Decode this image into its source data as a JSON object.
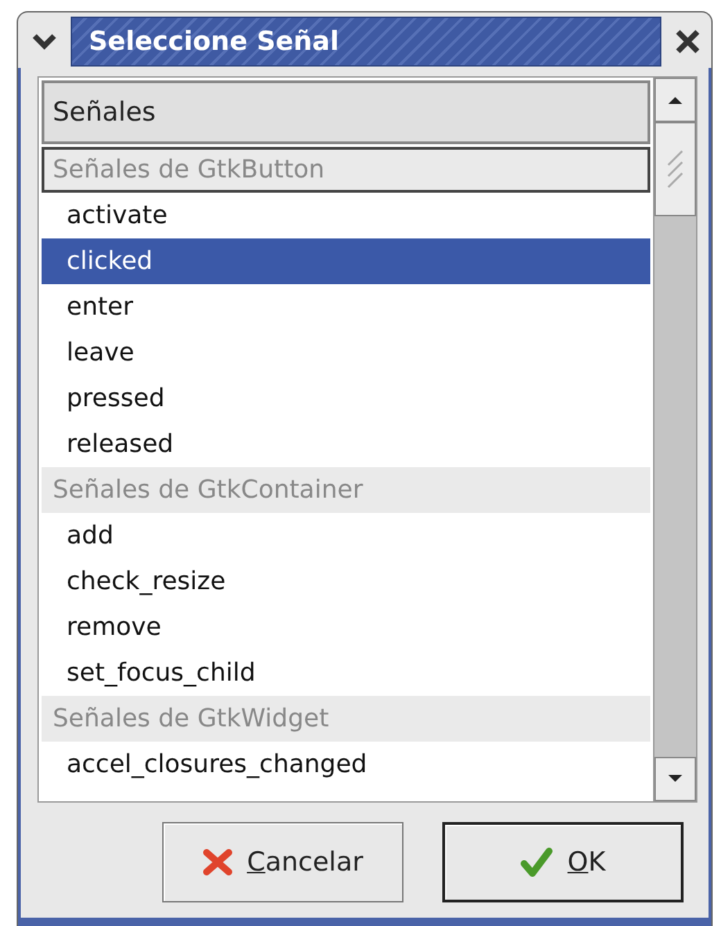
{
  "window": {
    "title": "Seleccione Señal"
  },
  "list": {
    "header": "Señales",
    "rows": [
      {
        "kind": "group",
        "label": "Señales de GtkButton",
        "selected": false,
        "focused": true
      },
      {
        "kind": "item",
        "label": "activate",
        "selected": false,
        "focused": false
      },
      {
        "kind": "item",
        "label": "clicked",
        "selected": true,
        "focused": false
      },
      {
        "kind": "item",
        "label": "enter",
        "selected": false,
        "focused": false
      },
      {
        "kind": "item",
        "label": "leave",
        "selected": false,
        "focused": false
      },
      {
        "kind": "item",
        "label": "pressed",
        "selected": false,
        "focused": false
      },
      {
        "kind": "item",
        "label": "released",
        "selected": false,
        "focused": false
      },
      {
        "kind": "group",
        "label": "Señales de GtkContainer",
        "selected": false,
        "focused": false
      },
      {
        "kind": "item",
        "label": "add",
        "selected": false,
        "focused": false
      },
      {
        "kind": "item",
        "label": "check_resize",
        "selected": false,
        "focused": false
      },
      {
        "kind": "item",
        "label": "remove",
        "selected": false,
        "focused": false
      },
      {
        "kind": "item",
        "label": "set_focus_child",
        "selected": false,
        "focused": false
      },
      {
        "kind": "group",
        "label": "Señales de GtkWidget",
        "selected": false,
        "focused": false
      },
      {
        "kind": "item",
        "label": "accel_closures_changed",
        "selected": false,
        "focused": false
      }
    ]
  },
  "buttons": [
    {
      "kind": "cancel",
      "label": "Cancelar",
      "focused": false
    },
    {
      "kind": "ok",
      "label": "OK",
      "focused": true
    }
  ]
}
